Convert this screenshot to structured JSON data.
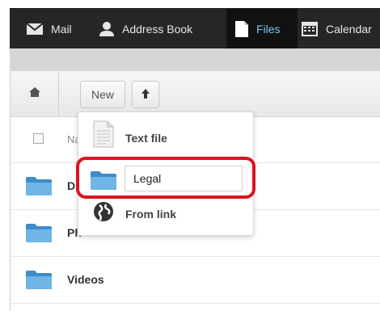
{
  "nav": {
    "items": [
      {
        "label": "Mail",
        "icon": "mail-icon"
      },
      {
        "label": "Address Book",
        "icon": "person-icon"
      },
      {
        "label": "Files",
        "icon": "document-icon"
      },
      {
        "label": "Calendar",
        "icon": "calendar-icon"
      }
    ],
    "active_color": "#7fc4f2"
  },
  "toolbar": {
    "new_label": "New",
    "home_icon": "home-icon",
    "up_icon": "arrow-up-icon"
  },
  "table": {
    "header_name": "Na"
  },
  "files": [
    {
      "name": "D"
    },
    {
      "name": "Ph"
    },
    {
      "name": "Videos"
    }
  ],
  "dropdown": {
    "text_file_label": "Text file",
    "folder_input_value": "Legal",
    "from_link_label": "From link"
  },
  "colors": {
    "highlight": "#d9141f",
    "folder": "#5fa8db"
  }
}
